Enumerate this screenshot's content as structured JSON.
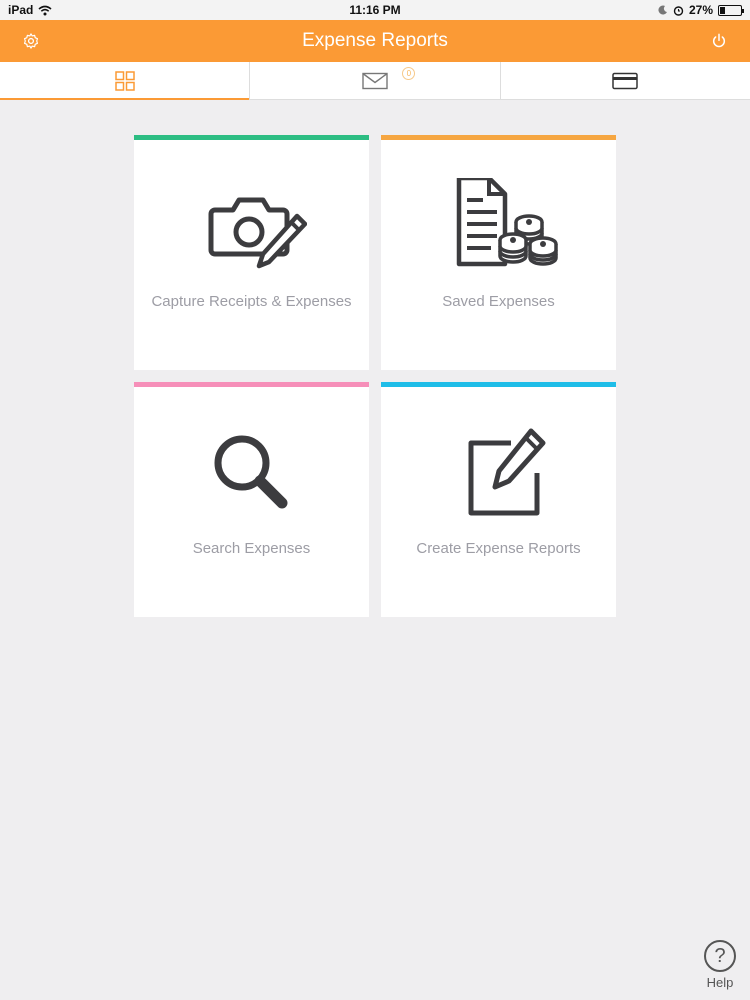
{
  "status_bar": {
    "device": "iPad",
    "time": "11:16 PM",
    "battery": "27%",
    "battery_level": 0.27
  },
  "header": {
    "title": "Expense Reports",
    "settings_icon": "gear-icon",
    "power_icon": "power-icon",
    "color": "#fb9a35"
  },
  "tabs": [
    {
      "icon": "grid-icon",
      "active": true
    },
    {
      "icon": "mail-icon",
      "badge": "0"
    },
    {
      "icon": "card-icon"
    }
  ],
  "cards": [
    {
      "label": "Capture Receipts & Expenses",
      "icon": "camera-pencil-icon",
      "accent": "#2dbd83"
    },
    {
      "label": "Saved Expenses",
      "icon": "document-coins-icon",
      "accent": "#f6a641"
    },
    {
      "label": "Search Expenses",
      "icon": "magnifier-icon",
      "accent": "#f68fb9"
    },
    {
      "label": "Create Expense Reports",
      "icon": "edit-icon",
      "accent": "#1fbde8"
    }
  ],
  "help": {
    "label": "Help",
    "glyph": "?"
  }
}
